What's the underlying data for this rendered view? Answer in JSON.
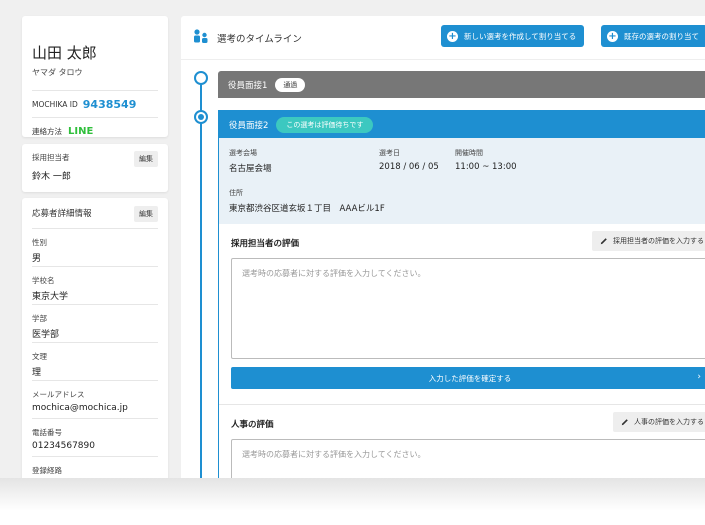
{
  "candidate": {
    "name": "山田 太郎",
    "kana": "ヤマダ タロウ",
    "id_label": "MOCHIKA ID",
    "id_value": "9438549",
    "contact_label": "連絡方法",
    "contact_value": "LINE"
  },
  "recruiter": {
    "label": "採用担当者",
    "edit_label": "編集",
    "value": "鈴木 一郎"
  },
  "details": {
    "heading": "応募者詳細情報",
    "edit_label": "編集",
    "fields": [
      {
        "label": "性別",
        "value": "男"
      },
      {
        "label": "学校名",
        "value": "東京大学"
      },
      {
        "label": "学部",
        "value": "医学部"
      },
      {
        "label": "文理",
        "value": "理"
      },
      {
        "label": "メールアドレス",
        "value": "mochica@mochica.jp"
      },
      {
        "label": "電話番号",
        "value": "01234567890"
      },
      {
        "label": "登録経路",
        "value": ""
      }
    ]
  },
  "timeline": {
    "title": "選考のタイムライン",
    "new_button": "新しい選考を作成して割り当てる",
    "existing_button": "既存の選考の割り当て",
    "stage1": {
      "title": "役員面接1",
      "badge": "通過"
    },
    "stage2": {
      "title": "役員面接2",
      "badge": "この選考は評価待ちです",
      "venue_label": "選考会場",
      "venue_value": "名古屋会場",
      "date_label": "選考日",
      "date_value": "2018 / 06 / 05",
      "time_label": "開催時間",
      "time_value": "11:00 ~ 13:00",
      "address_label": "住所",
      "address_value": "東京都渋谷区道玄坂１丁目　AAAビル1F"
    },
    "recruiter_eval": {
      "title": "採用担当者の評価",
      "button": "採用担当者の評価を入力する",
      "placeholder": "選考時の応募者に対する評価を入力してください。",
      "confirm": "入力した評価を確定する"
    },
    "hr_eval": {
      "title": "人事の評価",
      "button": "人事の評価を入力する",
      "placeholder": "選考時の応募者に対する評価を入力してください。"
    }
  },
  "colors": {
    "accent": "#1e8fd1",
    "line_green": "#2fbf3b",
    "teal_badge": "#3cc8c0",
    "gray_stage": "#777777"
  }
}
